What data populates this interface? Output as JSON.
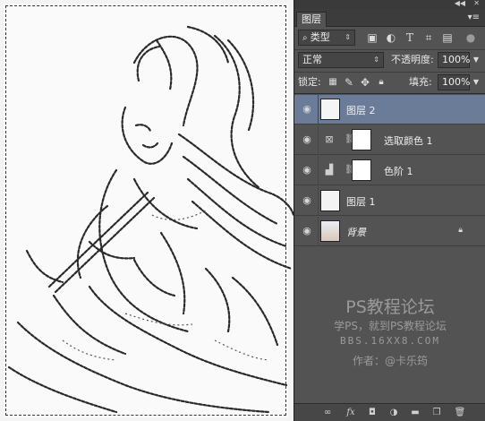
{
  "panel": {
    "tab_label": "图层",
    "filter": {
      "value": "类型",
      "icons": [
        "image-filter-icon",
        "adjustment-filter-icon",
        "type-filter-icon",
        "shape-filter-icon",
        "smart-object-filter-icon",
        "filter-toggle-icon"
      ]
    },
    "blend_mode": "正常",
    "opacity": {
      "label": "不透明度:",
      "value": "100%"
    },
    "lock": {
      "label": "锁定:"
    },
    "fill": {
      "label": "填充:",
      "value": "100%"
    }
  },
  "layers": [
    {
      "name": "图层 2",
      "kind": "pixel",
      "selected": true
    },
    {
      "name": "选取颜色 1",
      "kind": "adjustment",
      "icon": "selective-color-icon"
    },
    {
      "name": "色阶 1",
      "kind": "adjustment",
      "icon": "levels-icon"
    },
    {
      "name": "图层 1",
      "kind": "pixel"
    },
    {
      "name": "背景",
      "kind": "background",
      "locked": true
    }
  ],
  "watermark": {
    "line1": "PS教程论坛",
    "line2": "学PS，就到PS教程论坛",
    "line3": "BBS.16XX8.COM",
    "line4": "作者：@卡乐筠"
  },
  "colors": {
    "panel_bg": "#535353",
    "selected_layer": "#6a7c98",
    "canvas_bg": "#fafafa"
  }
}
